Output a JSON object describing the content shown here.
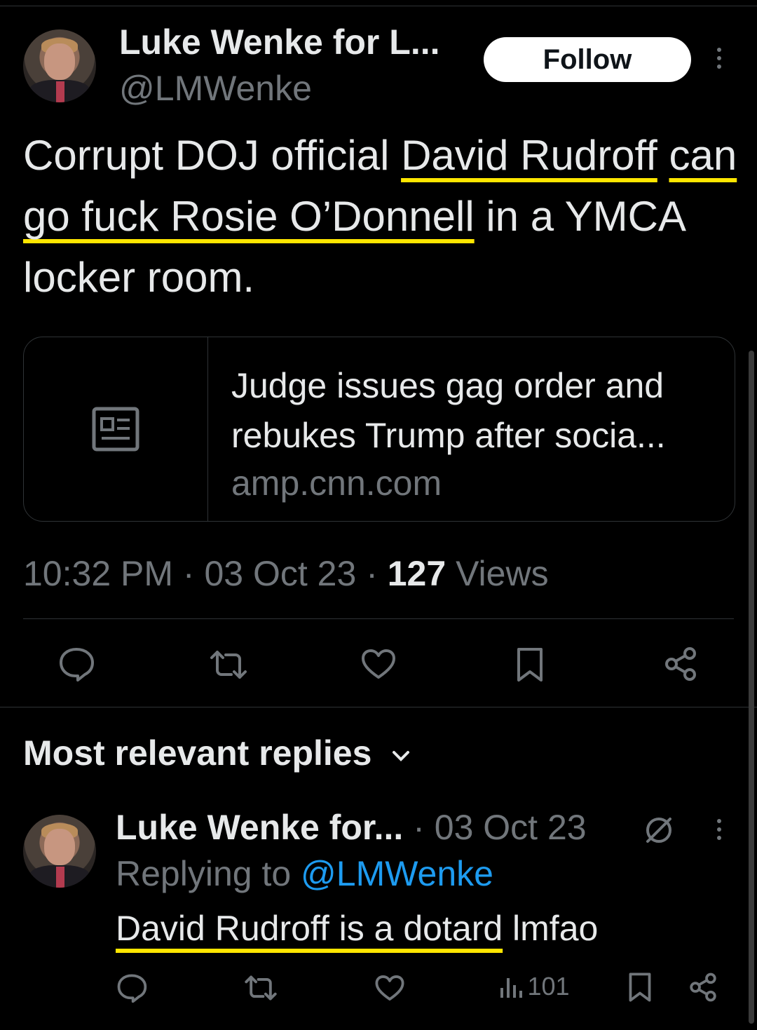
{
  "tweet": {
    "author_name": "Luke Wenke for L...",
    "author_handle": "@LMWenke",
    "follow_label": "Follow",
    "text_plain_1": "Corrupt DOJ official ",
    "text_underlined_1": "David Rudroff",
    "text_underlined_2": "can go fuck Rosie O’Donnell",
    "text_plain_2": " in a YMCA locker room.",
    "link_card": {
      "title": "Judge issues gag order and rebukes Trump after socia...",
      "domain": "amp.cnn.com",
      "icon": "news-article-icon"
    },
    "time": "10:32 PM",
    "date": "03 Oct 23",
    "views_count": "127",
    "views_label": "Views",
    "separator": "·",
    "actions": [
      "reply-icon",
      "retweet-icon",
      "like-icon",
      "bookmark-icon",
      "share-icon"
    ]
  },
  "replies_section": {
    "title": "Most relevant replies"
  },
  "reply": {
    "author_name": "Luke Wenke for...",
    "date": "03 Oct 23",
    "replying_prefix": "Replying to ",
    "replying_handle": "@LMWenke",
    "text_underlined": "David Rudroff is a dotard",
    "text_plain": " lmfao",
    "views_count": "101",
    "separator": "·",
    "badge_icon": "no-sign-icon"
  },
  "colors": {
    "background": "#000000",
    "text": "#e7e9ea",
    "muted": "#71767b",
    "link": "#1d9bf0",
    "highlight_underline": "#ffe600",
    "border": "#2f3336"
  }
}
